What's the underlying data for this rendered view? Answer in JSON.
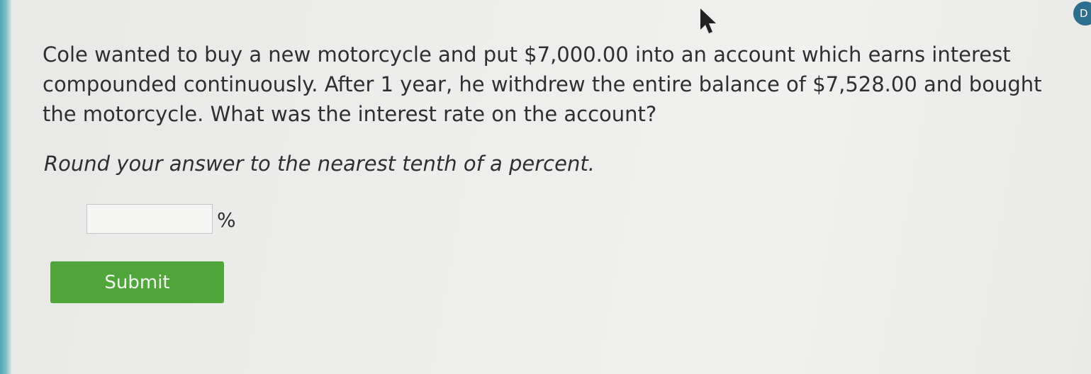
{
  "question": {
    "text": "Cole wanted to buy a new motorcycle and put $7,000.00 into an account which earns interest compounded continuously. After 1 year, he withdrew the entire balance of $7,528.00 and bought the motorcycle. What was the interest rate on the account?",
    "instruction": "Round your answer to the nearest tenth of a percent."
  },
  "answer": {
    "value": "",
    "unit": "%"
  },
  "submit": {
    "label": "Submit",
    "color": "#50a63a"
  },
  "corner_button": {
    "icon": "D"
  },
  "colors": {
    "text": "#2f2f33",
    "accent_edge": "#4fa7b4"
  }
}
